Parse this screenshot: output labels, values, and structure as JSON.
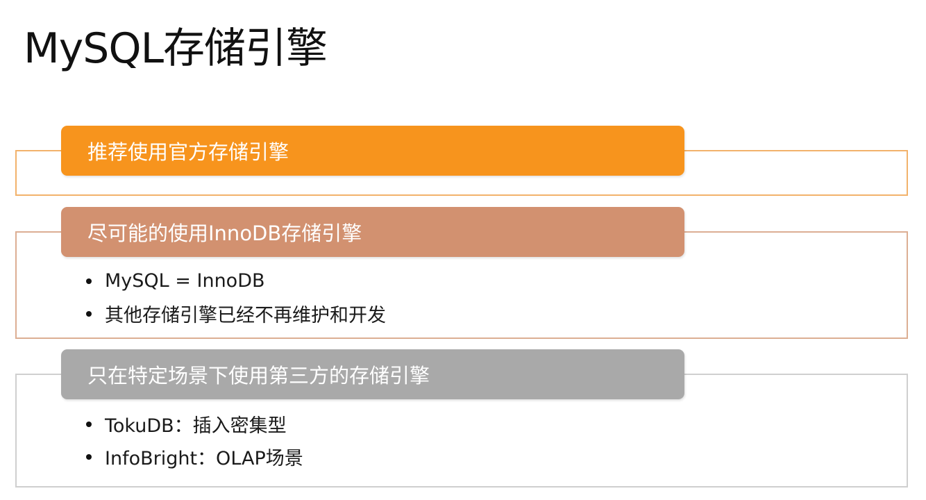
{
  "title": "MySQL存储引擎",
  "sections": [
    {
      "header": "推荐使用官方存储引擎",
      "header_color": "#f7941d",
      "border_color": "#f2b26b",
      "bullets": []
    },
    {
      "header": "尽可能的使用InnoDB存储引擎",
      "header_color": "#d29170",
      "border_color": "#dcae93",
      "bullets": [
        "MySQL = InnoDB",
        "其他存储引擎已经不再维护和开发"
      ]
    },
    {
      "header": "只在特定场景下使用第三方的存储引擎",
      "header_color": "#a9a9a9",
      "border_color": "#cfcfcf",
      "bullets": [
        "TokuDB：插入密集型",
        "InfoBright：OLAP场景"
      ]
    }
  ]
}
